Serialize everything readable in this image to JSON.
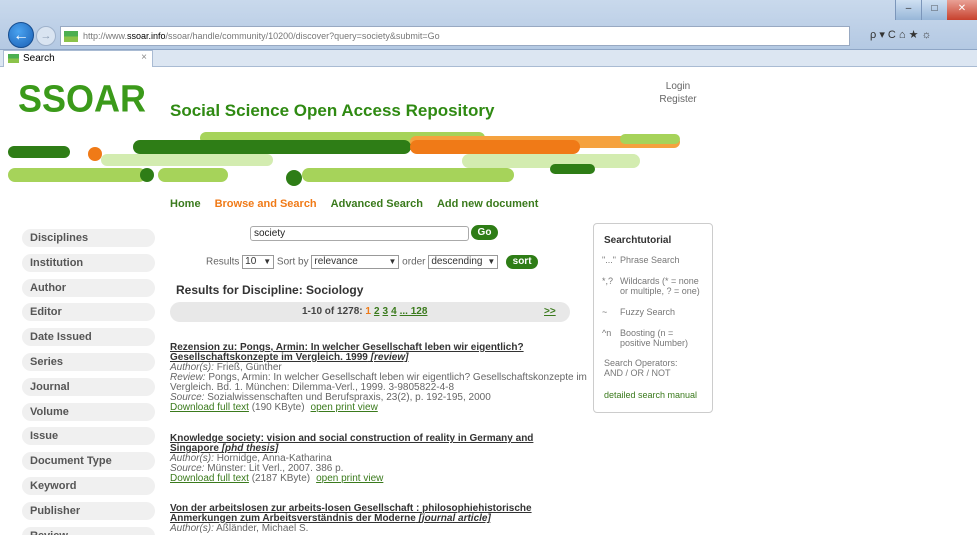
{
  "browser": {
    "url_prefix": "http://www.",
    "url_domain": "ssoar.info",
    "url_path": "/ssoar/handle/community/10200/discover?query=society&submit=Go",
    "tab_title": "Search",
    "tab_close": "×",
    "back_glyph": "←",
    "forward_glyph": "→",
    "address_tools": "ρ ▾ C  ⌂ ★ ☼",
    "win_min": "–",
    "win_max": "□",
    "win_close": "✕"
  },
  "header": {
    "logo": "SSOAR",
    "site_title": "Social Science Open Access Repository",
    "login": "Login",
    "register": "Register"
  },
  "topnav": {
    "home": "Home",
    "browse": "Browse and Search",
    "advanced": "Advanced Search",
    "add": "Add new document"
  },
  "sidebar": {
    "items": [
      "Disciplines",
      "Institution",
      "Author",
      "Editor",
      "Date Issued",
      "Series",
      "Journal",
      "Volume",
      "Issue",
      "Document Type",
      "Keyword",
      "Publisher",
      "Review"
    ]
  },
  "search": {
    "query": "society",
    "go_label": "Go",
    "results_label": "Results",
    "results_value": "10",
    "sortby_label": "Sort by",
    "sortby_value": "relevance",
    "order_label": "order",
    "order_value": "descending",
    "sort_button": "sort"
  },
  "results": {
    "heading": "Results for Discipline: Sociology",
    "pager_prefix": "1-10 of 1278:",
    "pager_current": "1",
    "pager_pages": [
      "2",
      "3",
      "4",
      "... 128"
    ],
    "pager_next": ">>",
    "items": [
      {
        "title_line1": "Rezension zu: Pongs, Armin: In welcher Gesellschaft leben wir eigentlich?",
        "title_line2": "Gesellschaftskonzepte im Vergleich. 1999",
        "doctype": "[review]",
        "author_label": "Author(s):",
        "author": "Frieß, Günther",
        "review_label": "Review:",
        "review_line1": "Pongs, Armin: In welcher Gesellschaft leben wir eigentlich? Gesellschaftskonzepte im",
        "review_line2": "Vergleich. Bd. 1. München: Dilemma-Verl., 1999. 3-9805822-4-8",
        "source_label": "Source:",
        "source": "Sozialwissenschaften und Berufspraxis, 23(2), p. 192-195, 2000",
        "download": "Download full text",
        "size": "(190 KByte)",
        "print": "open print view"
      },
      {
        "title_line1": "Knowledge society: vision and social construction of reality in Germany and",
        "title_line2": "Singapore",
        "doctype": "[phd thesis]",
        "author_label": "Author(s):",
        "author": "Hornidge, Anna-Katharina",
        "source_label": "Source:",
        "source": "Münster: Lit Verl., 2007. 386 p.",
        "download": "Download full text",
        "size": "(2187 KByte)",
        "print": "open print view"
      },
      {
        "title_line1": "Von der arbeitslosen zur arbeits-losen Gesellschaft : philosophiehistorische",
        "title_line2": "Anmerkungen zum Arbeitsverständnis der Moderne",
        "doctype": "[journal article]",
        "author_label": "Author(s):",
        "author": "Aßländer, Michael S."
      }
    ]
  },
  "tutorial": {
    "title": "Searchtutorial",
    "rows": [
      {
        "symbol": "\"...\"",
        "text": "Phrase Search"
      },
      {
        "symbol": "*,?",
        "text": "Wildcards (* = none or multiple, ? = one)"
      },
      {
        "symbol": "~",
        "text": "Fuzzy Search"
      },
      {
        "symbol": "^n",
        "text": "Boosting (n = positive Number)"
      }
    ],
    "operators_label": "Search Operators:",
    "operators": "AND / OR / NOT",
    "manual_link": "detailed search manual"
  },
  "colors": {
    "brand_green": "#3b9a1a",
    "dark_green": "#2e7d16",
    "orange": "#f07a17",
    "light_green": "#a6d35a",
    "pale_green": "#d3ecb0"
  }
}
